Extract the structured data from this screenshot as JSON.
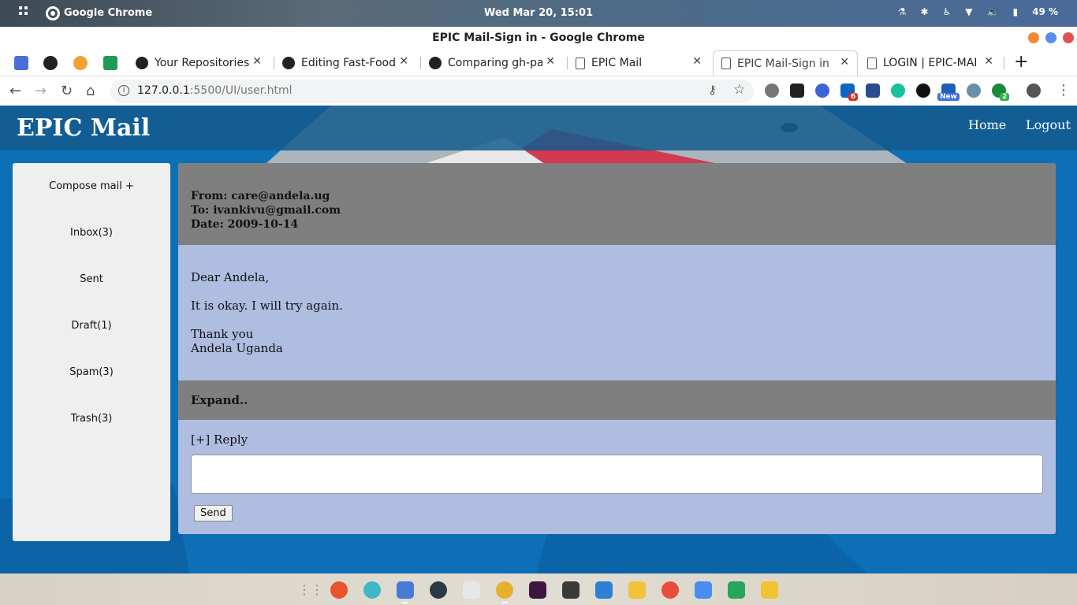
{
  "os": {
    "app_name": "Google Chrome",
    "clock": "Wed Mar 20, 15:01",
    "battery": "49 %"
  },
  "window": {
    "title": "EPIC Mail-Sign in - Google Chrome"
  },
  "tabs": [
    {
      "label": "Your Repositories",
      "icon": "github-icon"
    },
    {
      "label": "Editing Fast-Food",
      "icon": "github-icon"
    },
    {
      "label": "Comparing gh-pa",
      "icon": "github-icon"
    },
    {
      "label": "EPIC Mail",
      "icon": "document-icon"
    },
    {
      "label": "EPIC Mail-Sign in",
      "icon": "document-icon",
      "active": true
    },
    {
      "label": "LOGIN | EPIC-MAIL",
      "icon": "document-icon"
    }
  ],
  "address_bar": {
    "host": "127.0.0.1",
    "path": ":5500/UI/user.html"
  },
  "extensions": {
    "linkedin_badge": "6",
    "new_badge": "New",
    "green_badge": "2"
  },
  "site": {
    "logo": "EPIC Mail",
    "nav": {
      "home": "Home",
      "logout": "Logout"
    }
  },
  "sidebar": {
    "items": [
      {
        "label": "Compose mail +"
      },
      {
        "label": "Inbox(3)"
      },
      {
        "label": "Sent"
      },
      {
        "label": "Draft(1)"
      },
      {
        "label": "Spam(3)"
      },
      {
        "label": "Trash(3)"
      }
    ]
  },
  "mail": {
    "from": "From: care@andela.ug",
    "to": "To: ivankivu@gmail.com",
    "date": "Date: 2009-10-14",
    "greeting": "Dear Andela,",
    "body": "It is okay. I will try again.",
    "closing": "Thank you",
    "signature": "Andela Uganda",
    "expand": "Expand..",
    "reply_label": "[+] Reply",
    "reply_value": "",
    "send": "Send"
  },
  "colors": {
    "header_bg": "#145c8e",
    "page_bg": "#0d6fb6",
    "mail_head": "#7f7f7f",
    "mail_body": "#aebde0",
    "sidebar": "#efefef"
  }
}
